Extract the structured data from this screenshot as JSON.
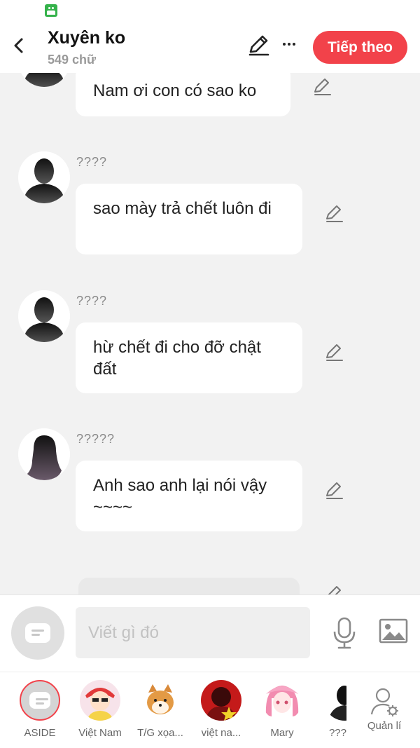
{
  "header": {
    "title": "Xuyên ko",
    "subtitle": "549 chữ",
    "next_label": "Tiếp theo"
  },
  "messages": [
    {
      "sender": "",
      "text": "Nam ơi con có sao ko",
      "avatar": "male-silhouette"
    },
    {
      "sender": "????",
      "text": "sao mày trả chết luôn đi",
      "avatar": "male-silhouette"
    },
    {
      "sender": "????",
      "text": "hừ chết đi cho đỡ chật đất",
      "avatar": "male-silhouette"
    },
    {
      "sender": "?????",
      "text": "Anh sao anh lại nói vậy ~~~~",
      "avatar": "female-silhouette"
    }
  ],
  "composer": {
    "placeholder": "Viết gì đó"
  },
  "characters": [
    {
      "name": "ASIDE",
      "icon": "message-icon",
      "active": true
    },
    {
      "name": "Việt Nam",
      "icon": "anime-character-avatar"
    },
    {
      "name": "T/G xọa...",
      "icon": "shiba-dog-avatar"
    },
    {
      "name": "việt na...",
      "icon": "red-avatar"
    },
    {
      "name": "Mary",
      "icon": "pink-hair-avatar"
    },
    {
      "name": "???",
      "icon": "male-silhouette"
    }
  ],
  "manage_label": "Quản lí",
  "colors": {
    "accent": "#f2424a",
    "background": "#f2f2f2",
    "bubble": "#ffffff"
  }
}
